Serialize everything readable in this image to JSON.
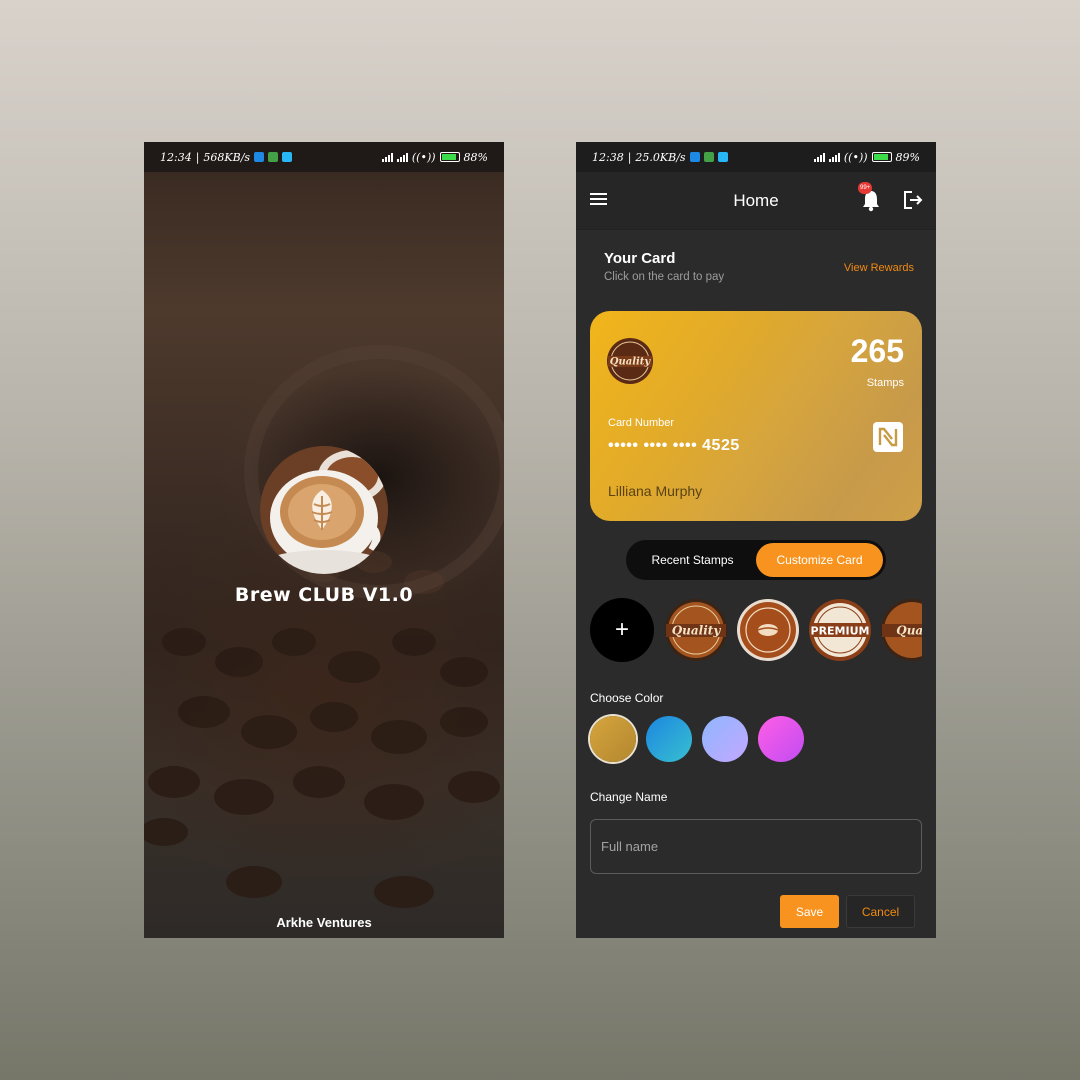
{
  "splash_screen": {
    "status_bar": {
      "time": "12:34",
      "net_speed": "568KB/s",
      "battery": "88%",
      "battery_level": 0.88
    },
    "app_name": "Brew CLUB V1.0",
    "footer": "Arkhe Ventures"
  },
  "home_screen": {
    "status_bar": {
      "time": "12:38",
      "net_speed": "25.0KB/s",
      "battery": "89%",
      "battery_level": 0.89
    },
    "appbar": {
      "title": "Home",
      "notification_badge": "99+"
    },
    "your_card": {
      "title": "Your Card",
      "subtitle": "Click on the card to pay",
      "view_rewards": "View Rewards"
    },
    "card": {
      "badge_text": "Quality",
      "points": "265",
      "points_label": "Stamps",
      "number_label": "Card Number",
      "number": "••••• •••• •••• 4525",
      "holder": "Lilliana Murphy"
    },
    "tabs": {
      "recent": "Recent Stamps",
      "customize": "Customize Card",
      "active": "customize"
    },
    "stamps": [
      {
        "name": "quality",
        "text": "Quality"
      },
      {
        "name": "bean",
        "text": ""
      },
      {
        "name": "premium",
        "text": "PREMIUM"
      },
      {
        "name": "quality-partial",
        "text": "Qual"
      }
    ],
    "choose_color_label": "Choose Color",
    "colors": [
      "#d6a53d",
      "#2ba0d8",
      "#a9a6ff",
      "#e256f0"
    ],
    "change_name_label": "Change Name",
    "name_placeholder": "Full name",
    "save": "Save",
    "cancel": "Cancel",
    "accent": "#f7931e"
  }
}
